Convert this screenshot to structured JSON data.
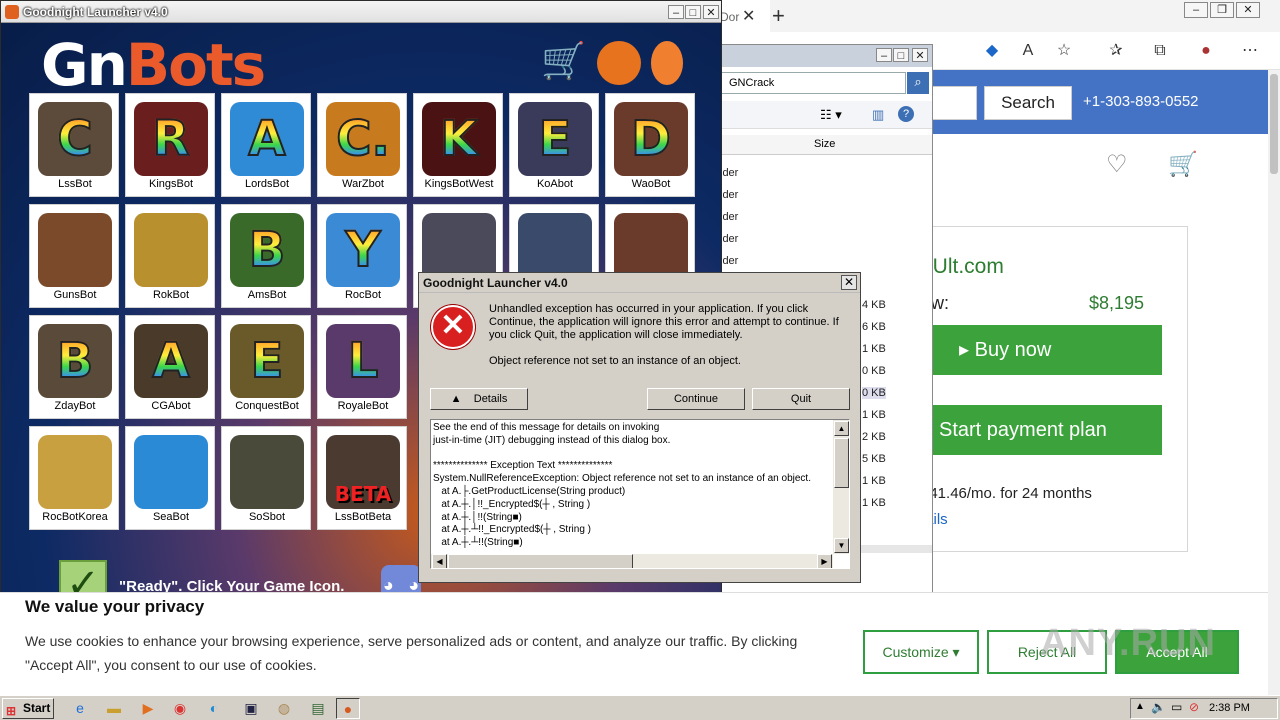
{
  "browser": {
    "tab_partial": "Dor",
    "toolbar_icons": [
      "shield-icon",
      "read-aloud-icon",
      "add-favorite-icon",
      "favorites-icon",
      "collections-icon",
      "profile-icon",
      "more-icon"
    ],
    "search_button": "Search",
    "phone": "+1-303-893-0552",
    "domain_fragment": "eUlt.com",
    "price_label": "ow:",
    "price": "$8,195",
    "buy_now": "Buy now",
    "payment_plan": "Start payment plan",
    "monthly": "341.46/mo. for 24 months",
    "details_link": "tails"
  },
  "explorer": {
    "address": "GNCrack",
    "col_size": "Size",
    "folder_rows": [
      "lder",
      "lder",
      "lder",
      "lder",
      "lder"
    ],
    "size_rows": [
      "4 KB",
      "6 KB",
      "1 KB",
      "0 KB",
      "0 KB",
      "1 KB",
      "2 KB",
      "5 KB",
      "1 KB",
      "1 KB"
    ]
  },
  "launcher": {
    "title": "Goodnight Launcher v4.0",
    "logo_gn": "Gn",
    "logo_bots": "Bots",
    "games": [
      {
        "label": "LssBot",
        "letter": "C",
        "color": "#5c4a3a"
      },
      {
        "label": "KingsBot",
        "letter": "R",
        "color": "#6b1e1e"
      },
      {
        "label": "LordsBot",
        "letter": "A",
        "color": "#2f8bd6"
      },
      {
        "label": "WarZbot",
        "letter": "C.",
        "color": "#c87a1e"
      },
      {
        "label": "KingsBotWest",
        "letter": "K",
        "color": "#4a1212"
      },
      {
        "label": "KoAbot",
        "letter": "E",
        "color": "#3a3a5a"
      },
      {
        "label": "WaoBot",
        "letter": "D",
        "color": "#6a3a2a"
      },
      {
        "label": "GunsBot",
        "letter": "",
        "color": "#7a4a2a"
      },
      {
        "label": "RokBot",
        "letter": "",
        "color": "#b8912e"
      },
      {
        "label": "AmsBot",
        "letter": "B",
        "color": "#3a6a2a"
      },
      {
        "label": "RocBot",
        "letter": "Y",
        "color": "#3a8ad6"
      },
      {
        "label": "ZdayBot",
        "letter": "B",
        "color": "#5a4a3a"
      },
      {
        "label": "CGAbot",
        "letter": "A",
        "color": "#4a3a2a"
      },
      {
        "label": "ConquestBot",
        "letter": "E",
        "color": "#6a5a2a"
      },
      {
        "label": "RoyaleBot",
        "letter": "L",
        "color": "#5a3a6a"
      },
      {
        "label": "RocBotKorea",
        "letter": "",
        "color": "#c8a040"
      },
      {
        "label": "SeaBot",
        "letter": "",
        "color": "#2a8ad6"
      },
      {
        "label": "SoSbot",
        "letter": "",
        "color": "#4a4a3a"
      },
      {
        "label": "LssBotBeta",
        "letter": "BETA",
        "color": "#4a3a30"
      }
    ],
    "partial_games": [
      {
        "color": "#4a4a5a"
      },
      {
        "color": "#3a4a6a"
      },
      {
        "color": "#6a3a2a"
      }
    ],
    "ready_text": "\"Ready\". Click Your Game Icon."
  },
  "dialog": {
    "title": "Goodnight Launcher v4.0",
    "message": "Unhandled exception has occurred in your application. If you click Continue, the application will ignore this error and attempt to continue. If you click Quit, the application will close immediately.",
    "message2": "Object reference not set to an instance of an object.",
    "details_button": "Details",
    "continue_button": "Continue",
    "quit_button": "Quit",
    "details_text": "See the end of this message for details on invoking\njust-in-time (JIT) debugging instead of this dialog box.\n\n************** Exception Text **************\nSystem.NullReferenceException: Object reference not set to an instance of an object.\n   at A.├.GetProductLicense(String product)\n   at A.┼.│!!_Encrypted$(┼ , String )\n   at A.┼.│!!(String■)\n   at A.┼.┴!!_Encrypted$(┼ , String )\n   at A.┼.┴!!(String■)"
  },
  "cookie": {
    "title": "We value your privacy",
    "text": "We use cookies to enhance your browsing experience, serve personalized ads or content, and analyze our traffic. By clicking \"Accept All\", you consent to our use of cookies.",
    "customize": "Customize ▾",
    "reject": "Reject All",
    "accept": "Accept All"
  },
  "taskbar": {
    "start": "Start",
    "clock": "2:38 PM"
  },
  "watermark": "ANY.RUN"
}
